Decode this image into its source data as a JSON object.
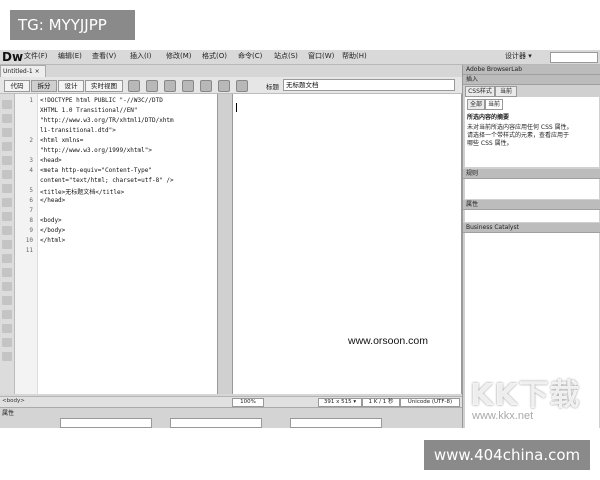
{
  "overlay": {
    "tg_label": "TG: MYYJJPP",
    "watermark_orsoon": "www.orsoon.com",
    "watermark_kk": "KK下载",
    "watermark_kkx": "www.kkx.net",
    "badge_404": "www.404china.com"
  },
  "app": {
    "logo": "Dw",
    "menu": [
      "文件(F)",
      "编辑(E)",
      "查看(V)",
      "插入(I)",
      "修改(M)",
      "格式(O)",
      "命令(C)",
      "站点(S)",
      "窗口(W)",
      "帮助(H)"
    ],
    "workspace_label": "设计器 ▾",
    "doc_tab": "Untitled-1 ×",
    "views": {
      "code": "代码",
      "split": "拆分",
      "design": "设计",
      "live": "实时视图"
    },
    "title_label": "标题",
    "title_value": "无标题文档"
  },
  "code": {
    "line_numbers": [
      "1",
      "",
      "",
      "",
      "2",
      "",
      "3",
      "4",
      "",
      "5",
      "6",
      "7",
      "8",
      "9",
      "10",
      "11"
    ],
    "lines": [
      "<!DOCTYPE html PUBLIC \"-//W3C//DTD",
      "XHTML 1.0 Transitional//EN\"",
      "\"http://www.w3.org/TR/xhtml1/DTD/xhtm",
      "l1-transitional.dtd\">",
      "<html xmlns=",
      "\"http://www.w3.org/1999/xhtml\">",
      "<head>",
      "<meta http-equiv=\"Content-Type\"",
      "content=\"text/html; charset=utf-8\" />",
      "<title>无标题文档</title>",
      "</head>",
      "",
      "<body>",
      "</body>",
      "</html>",
      ""
    ]
  },
  "status": {
    "left": "<body>",
    "zoom": "100%",
    "size": "391 x 515 ▾",
    "kb": "1 K / 1 秒",
    "encoding": "Unicode (UTF-8)"
  },
  "properties": {
    "title": "属性"
  },
  "right_panel": {
    "browserlab": "Adobe BrowserLab",
    "insert": "插入",
    "css_tab": "CSS样式",
    "current_tab": "当前",
    "all_tab": "全部",
    "current_tab2": "当前",
    "summary_title": "所选内容的摘要",
    "summary_text": [
      "未对当前所选内容应用任何 CSS 属性。",
      "请选择一个带样式的元素，查看应用于",
      "哪些 CSS 属性。"
    ],
    "rules": "规则",
    "props": "属性",
    "business": "Business Catalyst"
  }
}
